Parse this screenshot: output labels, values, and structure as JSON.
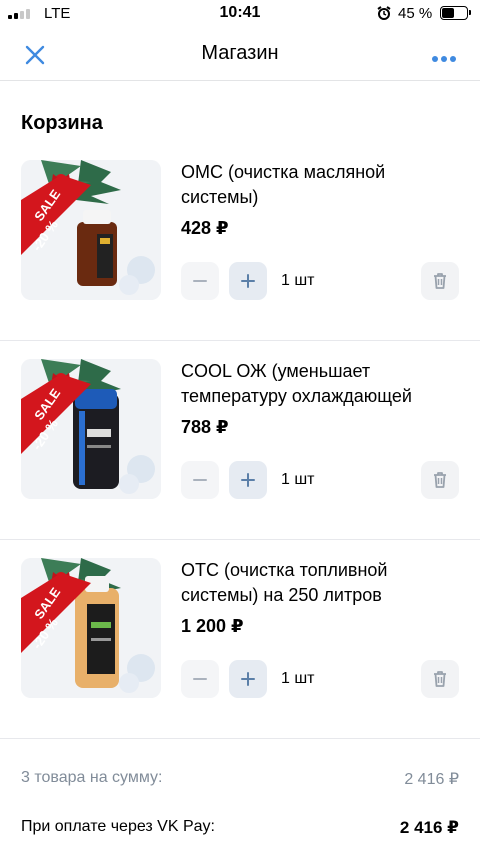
{
  "status_bar": {
    "carrier": "LTE",
    "time": "10:41",
    "battery_percent": "45 %",
    "battery_level": 0.45
  },
  "header": {
    "title": "Магазин",
    "close_icon": "close-icon",
    "more_icon": "more-dots-icon"
  },
  "cart": {
    "title": "Корзина",
    "items": [
      {
        "name": "ОМС (очистка масляной системы)",
        "price": "428 ₽",
        "quantity": "1 шт",
        "badge": "SALE -20 %"
      },
      {
        "name": "COOL ОЖ (уменьшает температуру охлаждающей",
        "price": "788 ₽",
        "quantity": "1 шт",
        "badge": "SALE -20 %"
      },
      {
        "name": "ОТС (очистка топливной системы) на 250 литров",
        "price": "1 200 ₽",
        "quantity": "1 шт",
        "badge": "SALE -20 %"
      }
    ]
  },
  "summary": {
    "items_total_label": "3 товара на сумму:",
    "items_total_value": "2 416 ₽",
    "pay_label": "При оплате через VK Pay:",
    "pay_value": "2 416 ₽"
  },
  "colors": {
    "accent": "#3f8ae0",
    "secondary_text": "#818c99",
    "sale_red": "#d3161d"
  }
}
